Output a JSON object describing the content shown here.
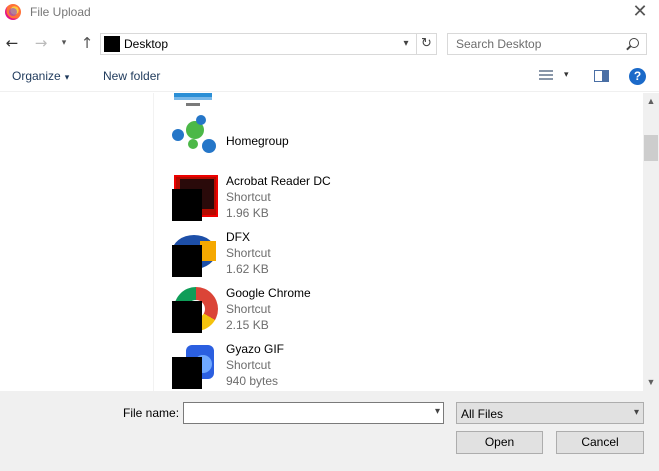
{
  "window": {
    "title": "File Upload",
    "close_glyph": "✕"
  },
  "nav": {
    "back_glyph": "←",
    "forward_glyph": "→",
    "recent_glyph": "▾",
    "up_glyph": "↑",
    "address": "Desktop",
    "dropdown_glyph": "▾",
    "refresh_glyph": "↻",
    "search_placeholder": "Search Desktop"
  },
  "toolbar": {
    "organize": "Organize",
    "organize_caret": "▾",
    "new_folder": "New folder",
    "view_caret": "▾",
    "help": "?"
  },
  "files": [
    {
      "name": "Homegroup"
    },
    {
      "name": "Acrobat Reader DC",
      "type": "Shortcut",
      "size": "1.96 KB"
    },
    {
      "name": "DFX",
      "type": "Shortcut",
      "size": "1.62 KB"
    },
    {
      "name": "Google Chrome",
      "type": "Shortcut",
      "size": "2.15 KB"
    },
    {
      "name": "Gyazo GIF",
      "type": "Shortcut",
      "size": "940 bytes"
    }
  ],
  "scrollbar": {
    "up_glyph": "▲",
    "down_glyph": "▼"
  },
  "footer": {
    "file_name_label": "File name:",
    "file_name_value": "",
    "file_name_caret": "▾",
    "filter": "All Files",
    "filter_caret": "▾",
    "open": "Open",
    "cancel": "Cancel"
  }
}
